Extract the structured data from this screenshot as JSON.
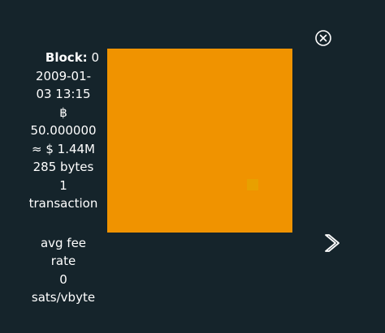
{
  "block": {
    "label": "Block:",
    "height": "0",
    "timestamp_line1": "2009-01-",
    "timestamp_line2": "03 13:15",
    "btc_symbol": "฿",
    "btc_amount": "50.000000",
    "usd_value": "≈ $ 1.44M",
    "size": "285 bytes",
    "tx_count": "1",
    "tx_label": "transaction",
    "fee_label_1": "avg fee",
    "fee_label_2": "rate",
    "fee_value": "0",
    "fee_unit": "sats/vbyte"
  },
  "icons": {
    "close": "close-circle-icon",
    "next": "chevron-right-icon"
  },
  "colors": {
    "background": "#15242b",
    "block_fill": "#f09300",
    "transaction_square": "#e8a000",
    "text": "#ffffff"
  }
}
